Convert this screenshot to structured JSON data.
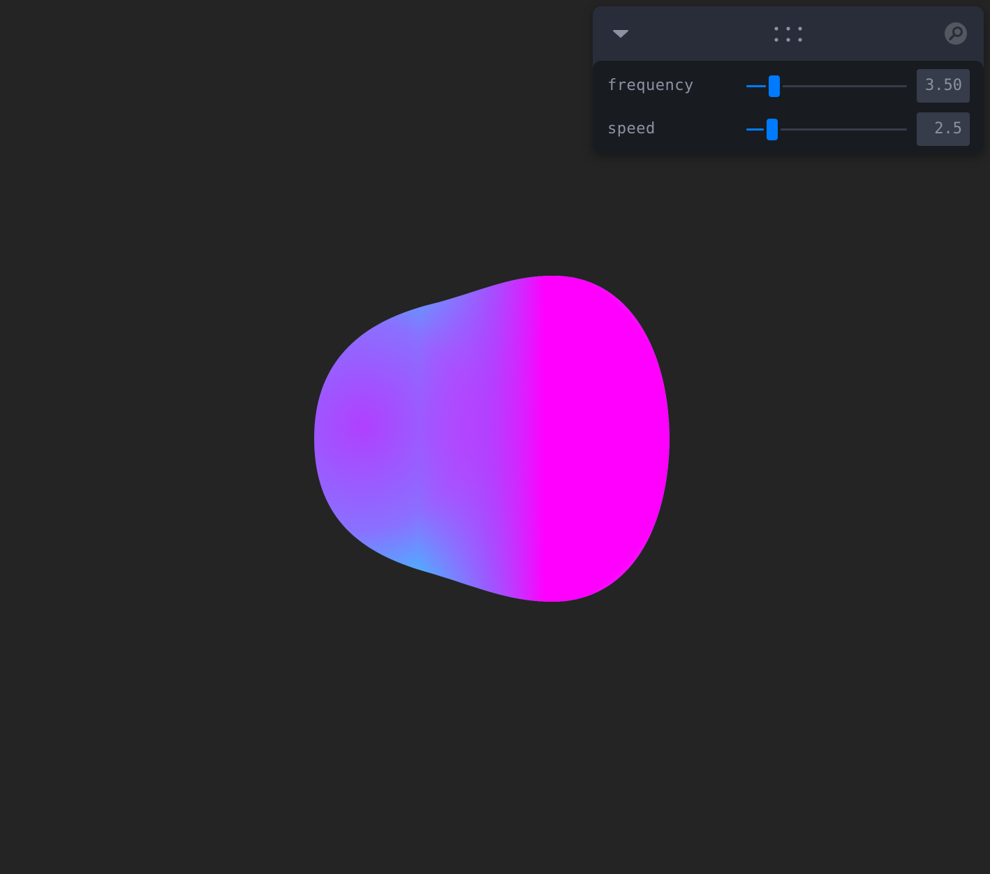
{
  "scene": {
    "background": "#242424",
    "object": "blob-mesh",
    "colors": {
      "cyan": "#00ffff",
      "magenta": "#ff00ff",
      "violet": "#b040ff"
    }
  },
  "panel": {
    "collapse_icon": "chevron-down-icon",
    "drag_icon": "grip-dots-icon",
    "search_icon": "search-icon",
    "accent": "#007bff",
    "controls": [
      {
        "label": "frequency",
        "value": "3.50",
        "fraction": 0.175
      },
      {
        "label": "speed",
        "value": "2.5",
        "fraction": 0.16
      }
    ]
  }
}
